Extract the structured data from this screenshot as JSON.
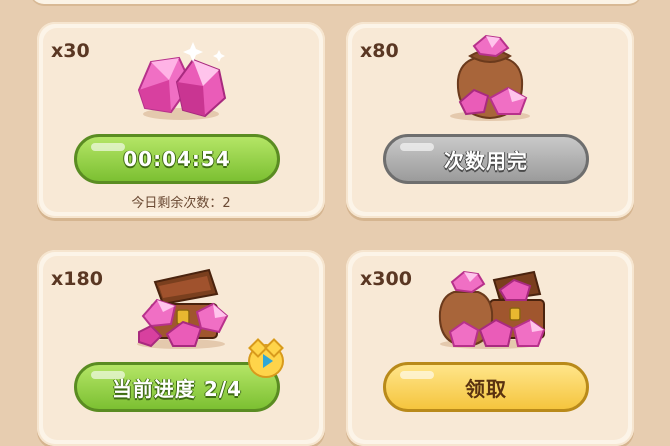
{
  "cards": [
    {
      "count": "x30",
      "art": "pink-gems-icon",
      "button": {
        "label": "00:04:54",
        "style": "green"
      },
      "sub": "今日剩余次数：2"
    },
    {
      "count": "x80",
      "art": "gem-sack-icon",
      "button": {
        "label": "次数用完",
        "style": "gray"
      },
      "sub": ""
    },
    {
      "count": "x180",
      "art": "gem-chest-icon",
      "button": {
        "label": "当前进度 2/4",
        "style": "green"
      },
      "sub": ""
    },
    {
      "count": "x300",
      "art": "gem-sack-and-chest-icon",
      "button": {
        "label": "领取",
        "style": "yellow"
      },
      "sub": ""
    }
  ],
  "colors": {
    "background": "#e7cdb0",
    "card": "#fcf4e8",
    "count_text": "#5a3723",
    "gem_pink": "#e64fb2",
    "green_button": "#8ccf3c",
    "gray_button": "#a8a8a8",
    "yellow_button": "#f8d45a"
  },
  "badge": {
    "icon": "video-play-icon"
  }
}
